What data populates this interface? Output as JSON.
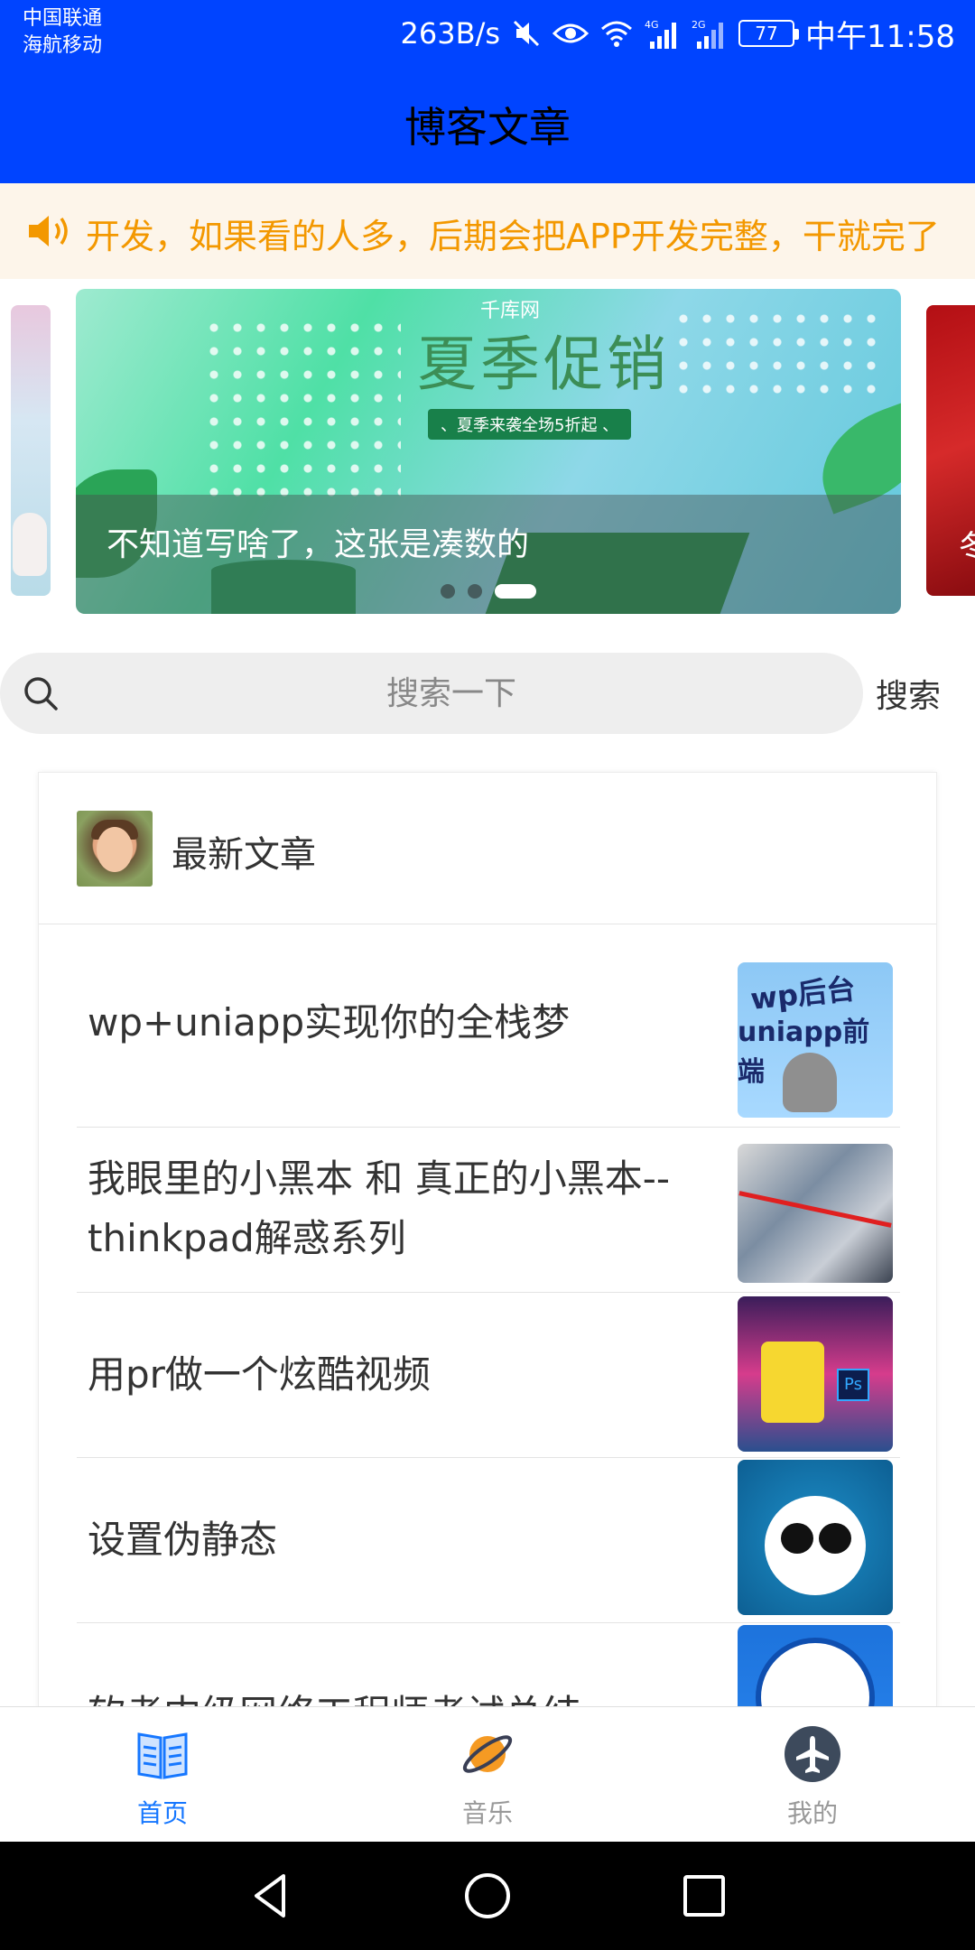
{
  "status_bar": {
    "carrier_1": "中国联通",
    "carrier_2": "海航移动",
    "net_speed": "263B/s",
    "battery": "77",
    "time": "中午11:58",
    "icons": [
      "mute-icon",
      "eye-icon",
      "wifi-icon",
      "signal-4g-icon",
      "signal-2g-icon",
      "battery-icon"
    ]
  },
  "header": {
    "title": "博客文章"
  },
  "notice": {
    "icon": "speaker-icon",
    "text": "开发，如果看的人多，后期会把APP开发完整，干就完了"
  },
  "swiper": {
    "caption": "不知道写啥了，这张是凑数的",
    "banner_site": "千库网",
    "banner_headline": "夏季促销",
    "banner_tag": "、夏季来袭全场5折起 、",
    "next_slide_text": "冬",
    "dots": [
      false,
      false,
      true
    ]
  },
  "search": {
    "placeholder": "搜索一下",
    "value": "",
    "button_label": "搜索"
  },
  "articles_card": {
    "title": "最新文章",
    "items": [
      {
        "title": "wp+uniapp实现你的全栈梦",
        "thumb_line1": "wp后台",
        "thumb_line2": "uniapp前端"
      },
      {
        "title": "我眼里的小黑本 和 真正的小黑本--thinkpad解惑系列"
      },
      {
        "title": "用pr做一个炫酷视频",
        "thumb_label": "Ps"
      },
      {
        "title": "设置伪静态"
      },
      {
        "title": "软考中级网络工程师考试总结"
      }
    ]
  },
  "tabbar": {
    "tabs": [
      {
        "label": "首页",
        "icon": "book-icon",
        "active": true
      },
      {
        "label": "音乐",
        "icon": "planet-icon",
        "active": false
      },
      {
        "label": "我的",
        "icon": "airplane-icon",
        "active": false
      }
    ]
  },
  "colors": {
    "header_bg": "#0044ff",
    "notice_text": "#f39800",
    "notice_bg": "#fdf5ea",
    "tab_active": "#1677ff",
    "tab_inactive": "#999999"
  }
}
